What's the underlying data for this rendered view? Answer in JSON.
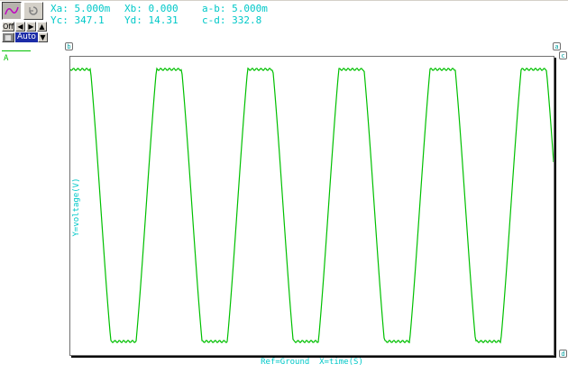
{
  "toolbar": {
    "off_label": "Off",
    "auto_label": "Auto"
  },
  "cursors": {
    "xa": "Xa: 5.000m",
    "xb": "Xb: 0.000",
    "ab": "a-b: 5.000m",
    "yc": "Yc: 347.1",
    "yd": "Yd: 14.31",
    "cd": "c-d: 332.8",
    "tags": {
      "a": "a",
      "b": "b",
      "c": "c",
      "d": "d"
    }
  },
  "trace": {
    "name": "A",
    "color": "#00c000"
  },
  "plot": {
    "ylabel": "Y=voltage(V)",
    "xlabel": "Ref=Ground  X=time(S)"
  },
  "colors": {
    "accent": "#00c8c8",
    "trace": "#00c000",
    "frame": "#d4d0c8"
  },
  "chart_data": {
    "type": "line",
    "series": [
      {
        "name": "A",
        "shape": "clipped-sine",
        "cycles": 5.3,
        "note_levels": {
          "high": 347.1,
          "low": 14.31
        }
      }
    ]
  }
}
